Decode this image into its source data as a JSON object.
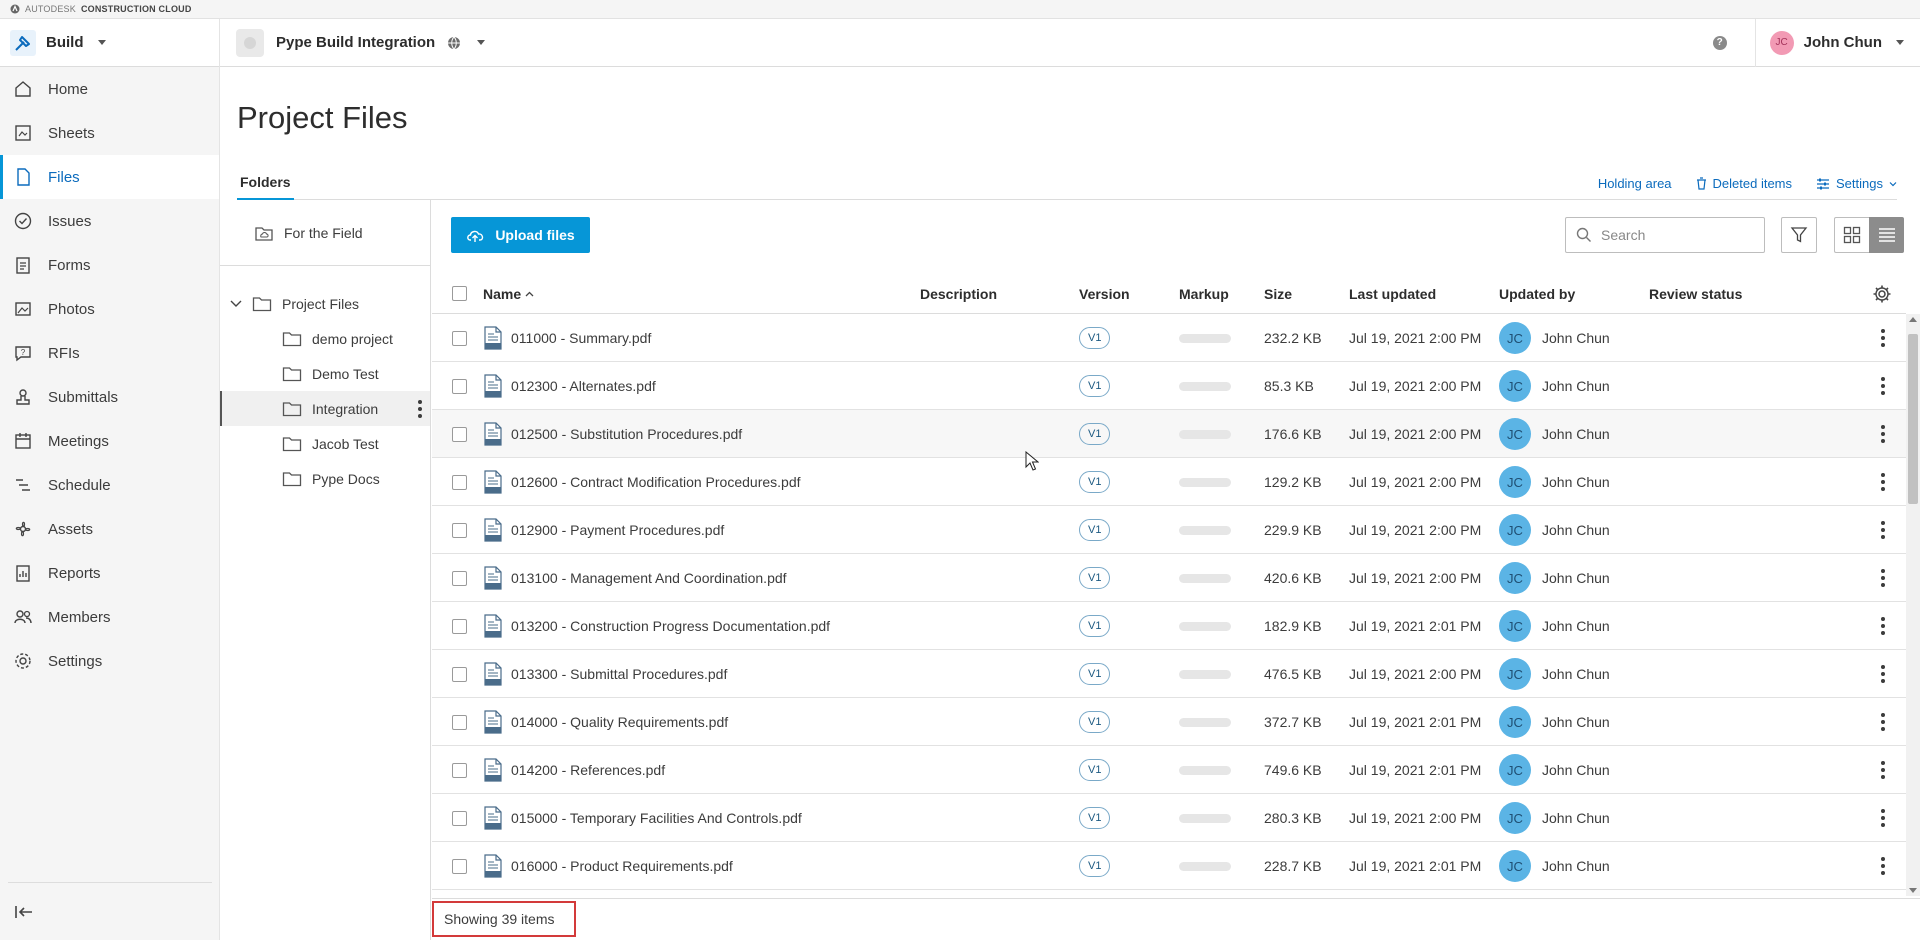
{
  "brand": {
    "company": "AUTODESK",
    "product": "CONSTRUCTION CLOUD"
  },
  "header": {
    "app_name": "Build",
    "project_name": "Pype Build Integration",
    "help_icon": "?",
    "user_initials": "JC",
    "user_name": "John Chun"
  },
  "sidebar": {
    "items": [
      {
        "label": "Home",
        "icon": "home-icon"
      },
      {
        "label": "Sheets",
        "icon": "sheets-icon"
      },
      {
        "label": "Files",
        "icon": "files-icon",
        "active": true
      },
      {
        "label": "Issues",
        "icon": "issues-icon"
      },
      {
        "label": "Forms",
        "icon": "forms-icon"
      },
      {
        "label": "Photos",
        "icon": "photos-icon"
      },
      {
        "label": "RFIs",
        "icon": "rfis-icon"
      },
      {
        "label": "Submittals",
        "icon": "submittals-icon"
      },
      {
        "label": "Meetings",
        "icon": "meetings-icon"
      },
      {
        "label": "Schedule",
        "icon": "schedule-icon"
      },
      {
        "label": "Assets",
        "icon": "assets-icon"
      },
      {
        "label": "Reports",
        "icon": "reports-icon"
      },
      {
        "label": "Members",
        "icon": "members-icon"
      },
      {
        "label": "Settings",
        "icon": "settings-icon"
      }
    ]
  },
  "page": {
    "title": "Project Files",
    "tab": "Folders",
    "actions": {
      "holding_area": "Holding area",
      "deleted_items": "Deleted items",
      "settings": "Settings"
    }
  },
  "tree": {
    "field": "For the Field",
    "root": "Project Files",
    "children": [
      "demo project",
      "Demo Test",
      "Integration",
      "Jacob Test",
      "Pype Docs"
    ],
    "selected_index": 2
  },
  "toolbar": {
    "upload_label": "Upload files",
    "search_placeholder": "Search"
  },
  "table": {
    "columns": {
      "name": "Name",
      "description": "Description",
      "version": "Version",
      "markup": "Markup",
      "size": "Size",
      "last_updated": "Last updated",
      "updated_by": "Updated by",
      "review_status": "Review status"
    },
    "rows": [
      {
        "name": "011000 - Summary.pdf",
        "version": "V1",
        "size": "232.2 KB",
        "updated": "Jul 19, 2021 2:00 PM",
        "initials": "JC",
        "by": "John Chun"
      },
      {
        "name": "012300 - Alternates.pdf",
        "version": "V1",
        "size": "85.3 KB",
        "updated": "Jul 19, 2021 2:00 PM",
        "initials": "JC",
        "by": "John Chun"
      },
      {
        "name": "012500 - Substitution Procedures.pdf",
        "version": "V1",
        "size": "176.6 KB",
        "updated": "Jul 19, 2021 2:00 PM",
        "initials": "JC",
        "by": "John Chun"
      },
      {
        "name": "012600 - Contract Modification Procedures.pdf",
        "version": "V1",
        "size": "129.2 KB",
        "updated": "Jul 19, 2021 2:00 PM",
        "initials": "JC",
        "by": "John Chun"
      },
      {
        "name": "012900 - Payment Procedures.pdf",
        "version": "V1",
        "size": "229.9 KB",
        "updated": "Jul 19, 2021 2:00 PM",
        "initials": "JC",
        "by": "John Chun"
      },
      {
        "name": "013100 - Management And Coordination.pdf",
        "version": "V1",
        "size": "420.6 KB",
        "updated": "Jul 19, 2021 2:00 PM",
        "initials": "JC",
        "by": "John Chun"
      },
      {
        "name": "013200 - Construction Progress Documentation.pdf",
        "version": "V1",
        "size": "182.9 KB",
        "updated": "Jul 19, 2021 2:01 PM",
        "initials": "JC",
        "by": "John Chun"
      },
      {
        "name": "013300 - Submittal Procedures.pdf",
        "version": "V1",
        "size": "476.5 KB",
        "updated": "Jul 19, 2021 2:00 PM",
        "initials": "JC",
        "by": "John Chun"
      },
      {
        "name": "014000 - Quality Requirements.pdf",
        "version": "V1",
        "size": "372.7 KB",
        "updated": "Jul 19, 2021 2:01 PM",
        "initials": "JC",
        "by": "John Chun"
      },
      {
        "name": "014200 - References.pdf",
        "version": "V1",
        "size": "749.6 KB",
        "updated": "Jul 19, 2021 2:01 PM",
        "initials": "JC",
        "by": "John Chun"
      },
      {
        "name": "015000 - Temporary Facilities And Controls.pdf",
        "version": "V1",
        "size": "280.3 KB",
        "updated": "Jul 19, 2021 2:00 PM",
        "initials": "JC",
        "by": "John Chun"
      },
      {
        "name": "016000 - Product Requirements.pdf",
        "version": "V1",
        "size": "228.7 KB",
        "updated": "Jul 19, 2021 2:01 PM",
        "initials": "JC",
        "by": "John Chun"
      }
    ]
  },
  "footer": {
    "count": "Showing 39 items"
  },
  "colors": {
    "accent": "#0696d7",
    "link": "#0b6bbd",
    "avatar": "#5bb4e5",
    "highlight_box": "#d33a3a"
  }
}
